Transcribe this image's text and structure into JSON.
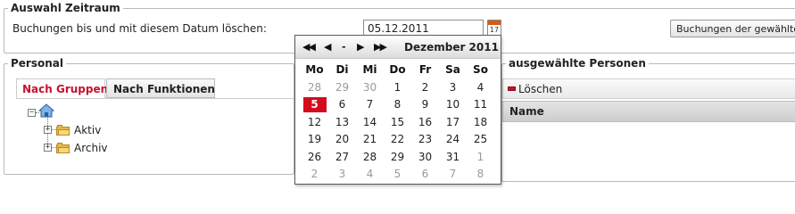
{
  "zeitraum": {
    "legend": "Auswahl Zeitraum",
    "label": "Buchungen bis und mit diesem Datum löschen:",
    "date_value": "05.12.2011",
    "calendar_icon_day": "17",
    "delete_button_label": "Buchungen der gewählten P"
  },
  "personal": {
    "legend": "Personal",
    "tabs": [
      {
        "label": "Nach Gruppen",
        "active": true
      },
      {
        "label": "Nach Funktionen",
        "active": false
      }
    ],
    "tree": {
      "root_icon": "home-icon",
      "root_toggle": "−",
      "items": [
        {
          "label": "Aktiv",
          "icon": "folder-icon",
          "toggle": "+"
        },
        {
          "label": "Archiv",
          "icon": "folder-icon",
          "toggle": "+"
        }
      ]
    }
  },
  "ausgewaehlte_personen": {
    "legend": "ausgewählte Personen",
    "delete_label": "Löschen",
    "column_header": "Name"
  },
  "calendar": {
    "nav": {
      "prev_year": "◀◀",
      "prev_month": "◀",
      "today": "-",
      "next_month": "▶",
      "next_year": "▶▶"
    },
    "title": "Dezember 2011",
    "weekdays": [
      "Mo",
      "Di",
      "Mi",
      "Do",
      "Fr",
      "Sa",
      "So"
    ],
    "weeks": [
      [
        {
          "d": "28",
          "o": true
        },
        {
          "d": "29",
          "o": true
        },
        {
          "d": "30",
          "o": true
        },
        {
          "d": "1"
        },
        {
          "d": "2"
        },
        {
          "d": "3"
        },
        {
          "d": "4"
        }
      ],
      [
        {
          "d": "5",
          "sel": true
        },
        {
          "d": "6"
        },
        {
          "d": "7"
        },
        {
          "d": "8"
        },
        {
          "d": "9"
        },
        {
          "d": "10"
        },
        {
          "d": "11"
        }
      ],
      [
        {
          "d": "12"
        },
        {
          "d": "13"
        },
        {
          "d": "14"
        },
        {
          "d": "15"
        },
        {
          "d": "16"
        },
        {
          "d": "17"
        },
        {
          "d": "18"
        }
      ],
      [
        {
          "d": "19"
        },
        {
          "d": "20"
        },
        {
          "d": "21"
        },
        {
          "d": "22"
        },
        {
          "d": "23"
        },
        {
          "d": "24"
        },
        {
          "d": "25"
        }
      ],
      [
        {
          "d": "26"
        },
        {
          "d": "27"
        },
        {
          "d": "28"
        },
        {
          "d": "29"
        },
        {
          "d": "30"
        },
        {
          "d": "31"
        },
        {
          "d": "1",
          "o": true
        }
      ],
      [
        {
          "d": "2",
          "o": true
        },
        {
          "d": "3",
          "o": true
        },
        {
          "d": "4",
          "o": true
        },
        {
          "d": "5",
          "o": true
        },
        {
          "d": "6",
          "o": true
        },
        {
          "d": "7",
          "o": true
        },
        {
          "d": "8",
          "o": true
        }
      ]
    ],
    "selected_color": "#d40a1d"
  },
  "colors": {
    "active_tab": "#c8102e",
    "border": "#b9b9b9"
  }
}
